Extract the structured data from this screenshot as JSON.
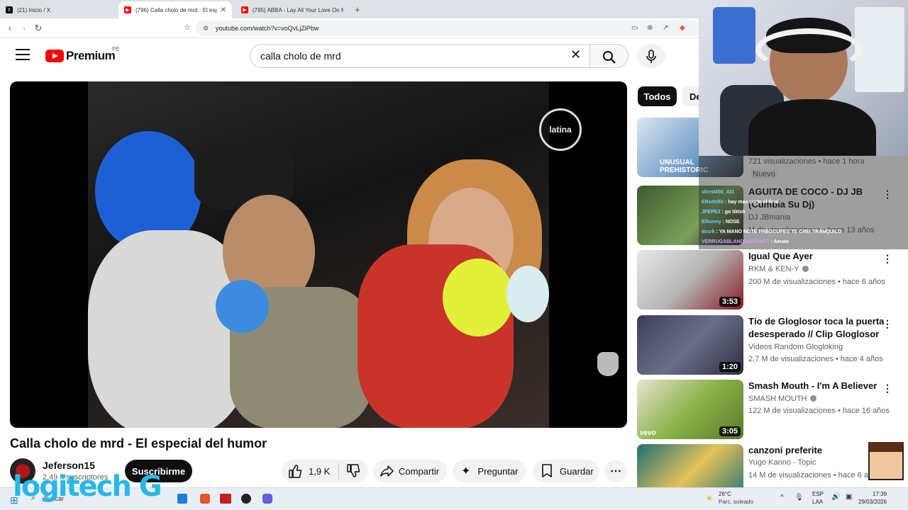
{
  "browser": {
    "tabs": [
      {
        "label": "(21) Inicio / X",
        "favicon": "x-logo"
      },
      {
        "label": "(796) Calla cholo de mrd - El esp",
        "favicon": "youtube-logo",
        "active": true
      },
      {
        "label": "(795) ABBA - Lay All Your Love On M",
        "favicon": "youtube-logo"
      }
    ],
    "url": "youtube.com/watch?v=voQvLjZiPbw"
  },
  "youtube": {
    "brand": "Premium",
    "country": "PE",
    "search_value": "calla cholo de mrd",
    "video_title": "Calla cholo de mrd - El especial del humor",
    "channel_name": "Jeferson15",
    "subscribers": "2,49 k suscriptores",
    "subscribe_label": "Suscribirme",
    "likes": "1,9 K",
    "share_label": "Compartir",
    "ask_label": "Preguntar",
    "save_label": "Guardar",
    "video_watermark": "latina"
  },
  "chips": [
    "Todos",
    "De"
  ],
  "recommendations": [
    {
      "title": "",
      "channel": "",
      "meta": "721 visualizaciones • hace 1 hora",
      "badge": "Nuevo",
      "duration": "",
      "thumb_text": "UNUSUAL PREHISTORIC"
    },
    {
      "title": "AGUITA DE COCO - DJ JB (Cumbia Su Dj)",
      "channel": "DJ JBmania",
      "meta": "M de visualizaciones • hace 13 años",
      "duration": ""
    },
    {
      "title": "Igual Que Ayer",
      "channel": "RKM & KEN-Y",
      "verified": true,
      "meta": "200 M de visualizaciones • hace 6 años",
      "duration": "3:53"
    },
    {
      "title": "Tío de Gloglosor toca la puerta desesperado // Clip Gloglosor",
      "channel": "Videos Random Glogloking",
      "meta": "2,7 M de visualizaciones • hace 4 años",
      "duration": "1:20"
    },
    {
      "title": "Smash Mouth - I'm A Believer",
      "channel": "SMASH MOUTH",
      "verified": true,
      "meta": "122 M de visualizaciones • hace 16 años",
      "duration": "3:05",
      "thumb_brand": "vevo"
    },
    {
      "title": "canzoni preferite",
      "channel": "Yugo Kanno - Topic",
      "meta": "14 M de visualizaciones • hace 6 años",
      "duration": ""
    }
  ],
  "chat": [
    {
      "user": "shred456_431",
      "msg": ""
    },
    {
      "user": "ERodolfo",
      "msg": "hay mas corto el final"
    },
    {
      "user": "JPEPE2",
      "msg": "go tiktok"
    },
    {
      "user": "Elbunny",
      "msg": "NOSE"
    },
    {
      "user": "dxsrk",
      "msg": "YA MANO NOTE PREOCUPES TE CREI TRANQUILO"
    },
    {
      "user": "VERRUGABLANDODICRAFT",
      "msg": "Aeuaa"
    }
  ],
  "taskbar": {
    "search": "Buscar",
    "weather_temp": "26°C",
    "weather_text": "Parc. soleado",
    "lang": "ESP",
    "lang2": "LAA",
    "time": "17:39",
    "date": "29/03/2026",
    "overlay_logo": "logitech G"
  },
  "colors": {
    "youtube_red": "#ff0000",
    "accent_dark": "#0f0f0f",
    "logitech_blue": "#26b8e8"
  }
}
